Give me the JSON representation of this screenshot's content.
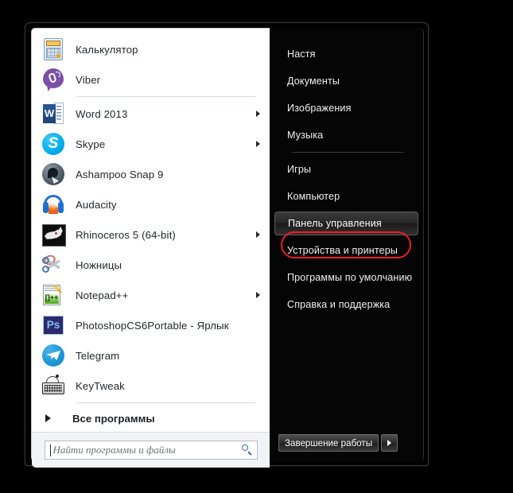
{
  "start_menu": {
    "left_panel": {
      "programs": [
        {
          "label": "Калькулятор",
          "icon": "calculator-icon",
          "has_submenu": false
        },
        {
          "label": "Viber",
          "icon": "viber-icon",
          "has_submenu": false
        },
        {
          "label": "Word 2013",
          "icon": "word-icon",
          "has_submenu": true
        },
        {
          "label": "Skype",
          "icon": "skype-icon",
          "has_submenu": true
        },
        {
          "label": "Ashampoo Snap 9",
          "icon": "ashampoo-snap-icon",
          "has_submenu": false
        },
        {
          "label": "Audacity",
          "icon": "audacity-icon",
          "has_submenu": false
        },
        {
          "label": "Rhinoceros 5 (64-bit)",
          "icon": "rhinoceros-icon",
          "has_submenu": true
        },
        {
          "label": "Ножницы",
          "icon": "snipping-tool-icon",
          "has_submenu": false
        },
        {
          "label": "Notepad++",
          "icon": "notepad-plus-icon",
          "has_submenu": true
        },
        {
          "label": "PhotoshopCS6Portable - Ярлык",
          "icon": "photoshop-icon",
          "has_submenu": false
        },
        {
          "label": "Telegram",
          "icon": "telegram-icon",
          "has_submenu": false
        },
        {
          "label": "KeyTweak",
          "icon": "keytweak-icon",
          "has_submenu": false
        }
      ],
      "all_programs_label": "Все программы",
      "search": {
        "placeholder": "Найти программы и файлы",
        "value": "",
        "icon": "search-icon"
      }
    },
    "right_panel": {
      "places": [
        {
          "label": "Настя",
          "highlighted": false
        },
        {
          "label": "Документы",
          "highlighted": false
        },
        {
          "label": "Изображения",
          "highlighted": false
        },
        {
          "label": "Музыка",
          "highlighted": false
        },
        {
          "label": "Игры",
          "highlighted": false
        },
        {
          "label": "Компьютер",
          "highlighted": false
        },
        {
          "label": "Панель управления",
          "highlighted": true
        },
        {
          "label": "Устройства и принтеры",
          "highlighted": false
        },
        {
          "label": "Программы по умолчанию",
          "highlighted": false
        },
        {
          "label": "Справка и поддержка",
          "highlighted": false
        }
      ],
      "shutdown_label": "Завершение работы",
      "shutdown_menu_icon": "chevron-right-icon"
    }
  },
  "annotation": {
    "highlight_color": "#ee1c25",
    "target_label": "Панель управления"
  }
}
